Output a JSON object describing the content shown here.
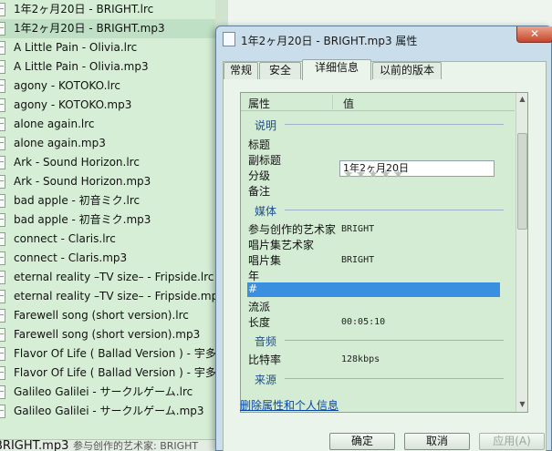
{
  "file_list": {
    "items": [
      "1年2ヶ月20日 - BRIGHT.lrc",
      "1年2ヶ月20日 - BRIGHT.mp3",
      "A Little Pain - Olivia.lrc",
      "A Little Pain - Olivia.mp3",
      "agony - KOTOKO.lrc",
      "agony - KOTOKO.mp3",
      "alone again.lrc",
      "alone again.mp3",
      "Ark - Sound Horizon.lrc",
      "Ark - Sound Horizon.mp3",
      "bad apple - 初音ミク.lrc",
      "bad apple - 初音ミク.mp3",
      "connect - Claris.lrc",
      "connect - Claris.mp3",
      "eternal reality –TV size– - Fripside.lrc",
      "eternal reality –TV size– - Fripside.mp3",
      "Farewell song (short version).lrc",
      "Farewell song (short version).mp3",
      "Flavor Of Life ( Ballad Version ) - 宇多田ヒカル.lrc",
      "Flavor Of Life ( Ballad Version ) - 宇多田ヒカル.mp3",
      "Galileo Galilei - サークルゲーム.lrc",
      "Galileo Galilei - サークルゲーム.mp3"
    ],
    "selected_index": 1
  },
  "status_bar": {
    "filename": "BRIGHT.mp3",
    "artist": "参与创作的艺术家: BRIGHT"
  },
  "dialog": {
    "title": "1年2ヶ月20日 - BRIGHT.mp3 属性",
    "close_label": "✕",
    "tabs": [
      "常规",
      "安全",
      "详细信息",
      "以前的版本"
    ],
    "active_tab": 2,
    "columns": {
      "property": "属性",
      "value": "值"
    },
    "sections": {
      "description": "说明",
      "media": "媒体",
      "audio": "音频",
      "source": "来源"
    },
    "properties": {
      "title_label": "标题",
      "title_value": "1年2ヶ月20日",
      "subtitle_label": "副标题",
      "rating_label": "分级",
      "rating_stars": "★★★★★",
      "rating_value": 0,
      "comment_label": "备注",
      "contributing_artist_label": "参与创作的艺术家",
      "contributing_artist_value": "BRIGHT",
      "album_artist_label": "唱片集艺术家",
      "album_label": "唱片集",
      "album_value": "BRIGHT",
      "year_label": "年",
      "track_label": "#",
      "genre_label": "流派",
      "length_label": "长度",
      "length_value": "00:05:10",
      "bitrate_label": "比特率",
      "bitrate_value": "128kbps"
    },
    "remove_link": "删除属性和个人信息",
    "buttons": {
      "ok": "确定",
      "cancel": "取消",
      "apply": "应用(A)"
    }
  }
}
